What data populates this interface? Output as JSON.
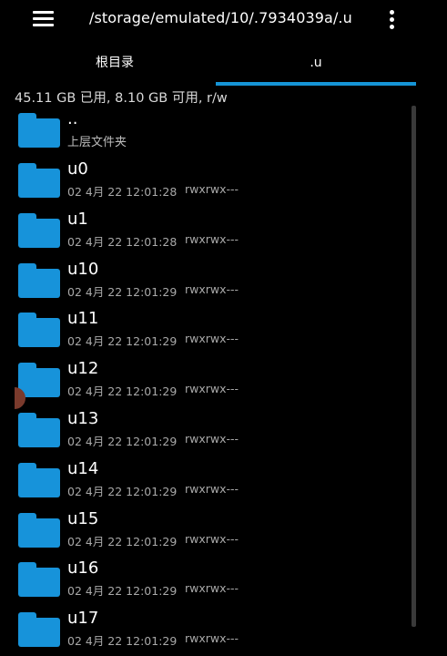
{
  "toolbar": {
    "path": "/storage/emulated/10/.7934039a/.u",
    "menu_icon": "hamburger-menu-icon",
    "more_icon": "more-vert-icon"
  },
  "tabs": [
    {
      "label": "根目录",
      "active": false
    },
    {
      "label": ".u",
      "active": true
    }
  ],
  "colors": {
    "accent": "#1594d6",
    "folder": "#1793da",
    "background": "#000000"
  },
  "storage_info": "45.11 GB 已用, 8.10 GB 可用, r/w",
  "parent": {
    "name": "..",
    "subtitle": "上层文件夹"
  },
  "items": [
    {
      "name": "u0",
      "date": "02 4月 22 12:01:28",
      "perm": "rwxrwx---"
    },
    {
      "name": "u1",
      "date": "02 4月 22 12:01:28",
      "perm": "rwxrwx---"
    },
    {
      "name": "u10",
      "date": "02 4月 22 12:01:29",
      "perm": "rwxrwx---"
    },
    {
      "name": "u11",
      "date": "02 4月 22 12:01:29",
      "perm": "rwxrwx---"
    },
    {
      "name": "u12",
      "date": "02 4月 22 12:01:29",
      "perm": "rwxrwx---"
    },
    {
      "name": "u13",
      "date": "02 4月 22 12:01:29",
      "perm": "rwxrwx---"
    },
    {
      "name": "u14",
      "date": "02 4月 22 12:01:29",
      "perm": "rwxrwx---"
    },
    {
      "name": "u15",
      "date": "02 4月 22 12:01:29",
      "perm": "rwxrwx---"
    },
    {
      "name": "u16",
      "date": "02 4月 22 12:01:29",
      "perm": "rwxrwx---"
    },
    {
      "name": "u17",
      "date": "02 4月 22 12:01:29",
      "perm": "rwxrwx---"
    }
  ]
}
